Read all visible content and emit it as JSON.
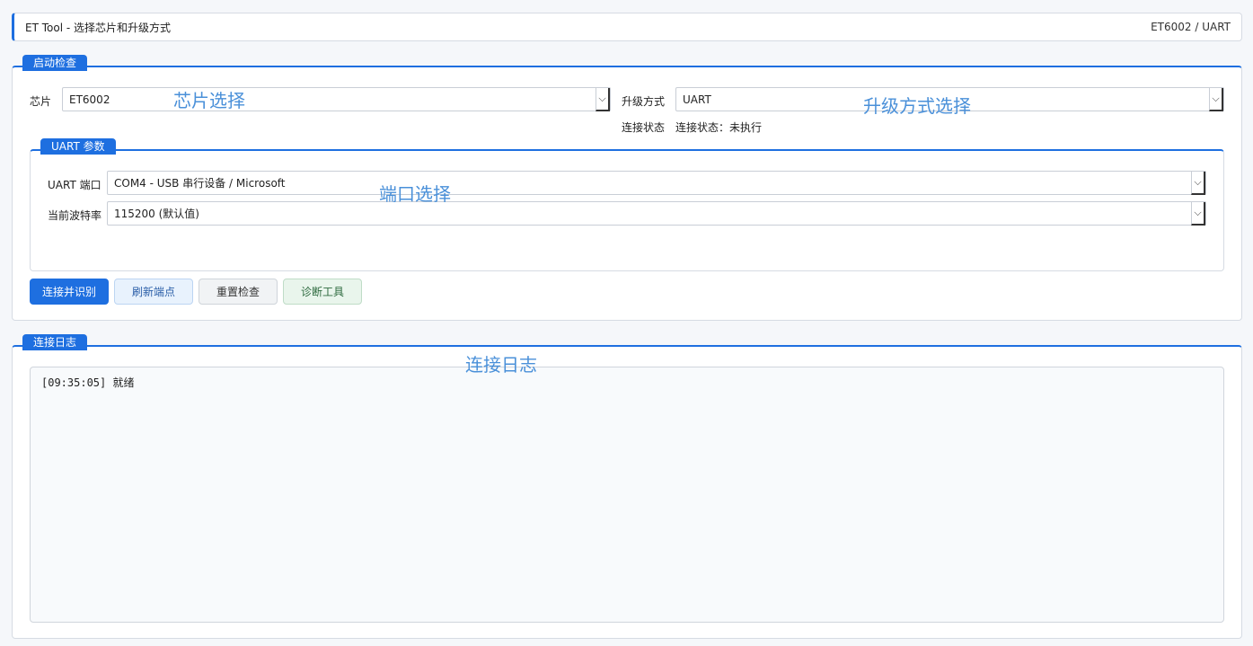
{
  "window": {
    "title": "ET Tool - 选择芯片和升级方式",
    "status_right": "ET6002 / UART"
  },
  "startup_check": {
    "tab": "启动检查",
    "chip_label": "芯片",
    "chip_value": "ET6002",
    "upgrade_label": "升级方式",
    "upgrade_value": "UART",
    "conn_label": "连接状态",
    "conn_value": "连接状态：未执行",
    "uart": {
      "tab": "UART 参数",
      "port_label": "UART 端口",
      "port_value": "COM4 - USB 串行设备 / Microsoft",
      "baud_label": "当前波特率",
      "baud_value": "115200 (默认值)"
    },
    "buttons": {
      "connect": "连接并识别",
      "refresh": "刷新端点",
      "reset": "重置检查",
      "diag": "诊断工具"
    }
  },
  "log": {
    "tab": "连接日志",
    "lines": [
      "[09:35:05] 就绪"
    ]
  },
  "annotations": {
    "chip_select": "芯片选择",
    "upgrade_select": "升级方式选择",
    "port_select": "端口选择",
    "log": "连接日志"
  },
  "icons": {
    "dropdown": "chevron-down-icon"
  },
  "colors": {
    "accent": "#1e6fe0",
    "annotation": "#4a90d9"
  }
}
